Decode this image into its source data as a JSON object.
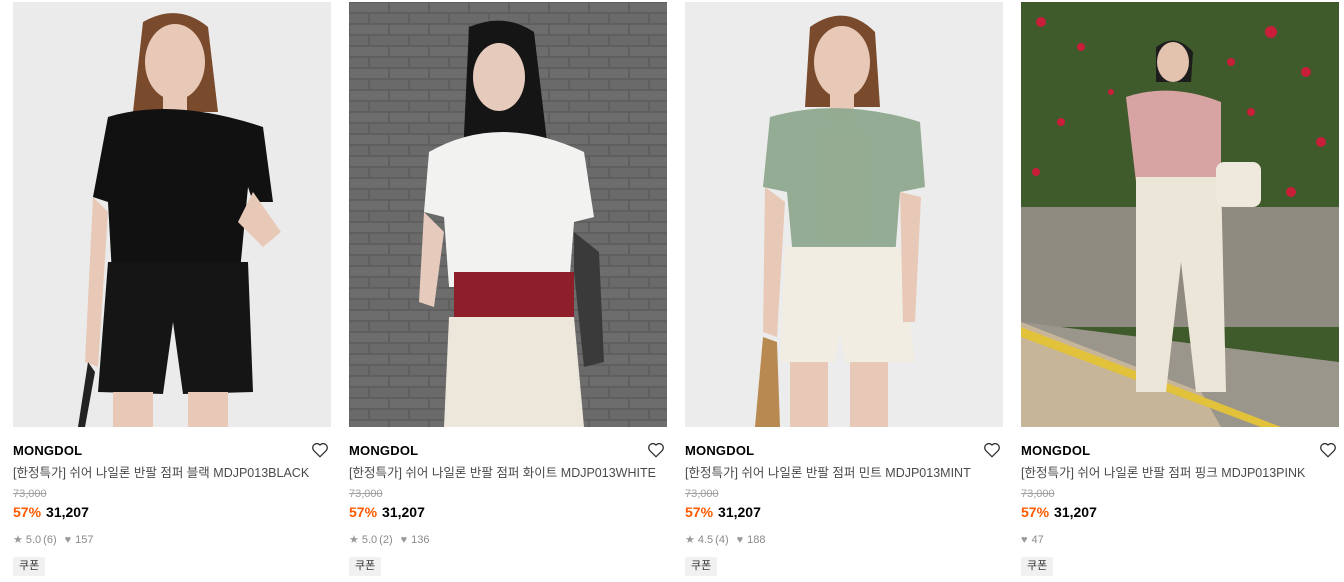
{
  "products": [
    {
      "brand": "MONGDOL",
      "name": "[한정특가] 쉬어 나일론 반팔 점퍼 블랙 MDJP013BLACK",
      "original_price": "73,000",
      "discount": "57%",
      "price": "31,207",
      "rating": "5.0",
      "review_count": "(6)",
      "likes": "157",
      "badge": "쿠폰",
      "colors": {
        "bg": "#ebebeb",
        "top": "#111111",
        "bottom": "#151515",
        "skin": "#e8c9b8",
        "hair": "#7a4a2c"
      }
    },
    {
      "brand": "MONGDOL",
      "name": "[한정특가] 쉬어 나일론 반팔 점퍼 화이트 MDJP013WHITE",
      "original_price": "73,000",
      "discount": "57%",
      "price": "31,207",
      "rating": "5.0",
      "review_count": "(2)",
      "likes": "136",
      "badge": "쿠폰",
      "colors": {
        "bg": "#6c6c6c",
        "top": "#f2f2f0",
        "bottom": "#ece7da",
        "skin": "#e6cbbd",
        "hair": "#151515",
        "inner": "#8e1e2a"
      }
    },
    {
      "brand": "MONGDOL",
      "name": "[한정특가] 쉬어 나일론 반팔 점퍼 민트 MDJP013MINT",
      "original_price": "73,000",
      "discount": "57%",
      "price": "31,207",
      "rating": "4.5",
      "review_count": "(4)",
      "likes": "188",
      "badge": "쿠폰",
      "colors": {
        "bg": "#ececec",
        "top": "#8fa98e",
        "bottom": "#f1ede3",
        "skin": "#e8c9b8",
        "hair": "#7a4a2c",
        "inner": "#eee5da"
      }
    },
    {
      "brand": "MONGDOL",
      "name": "[한정특가] 쉬어 나일론 반팔 점퍼 핑크 MDJP013PINK",
      "original_price": "73,000",
      "discount": "57%",
      "price": "31,207",
      "rating": "",
      "review_count": "",
      "likes": "47",
      "badge": "쿠폰",
      "colors": {
        "bg": "#3f5a2b",
        "top": "#d7a3a3",
        "bottom": "#ece6d8",
        "skin": "#e3c2ae",
        "hair": "#1d1d1d",
        "flower": "#c81e3a"
      }
    }
  ],
  "icons": {
    "wishlist": "heart-outline-icon",
    "rating": "star-icon",
    "likes": "heart-filled-icon"
  }
}
